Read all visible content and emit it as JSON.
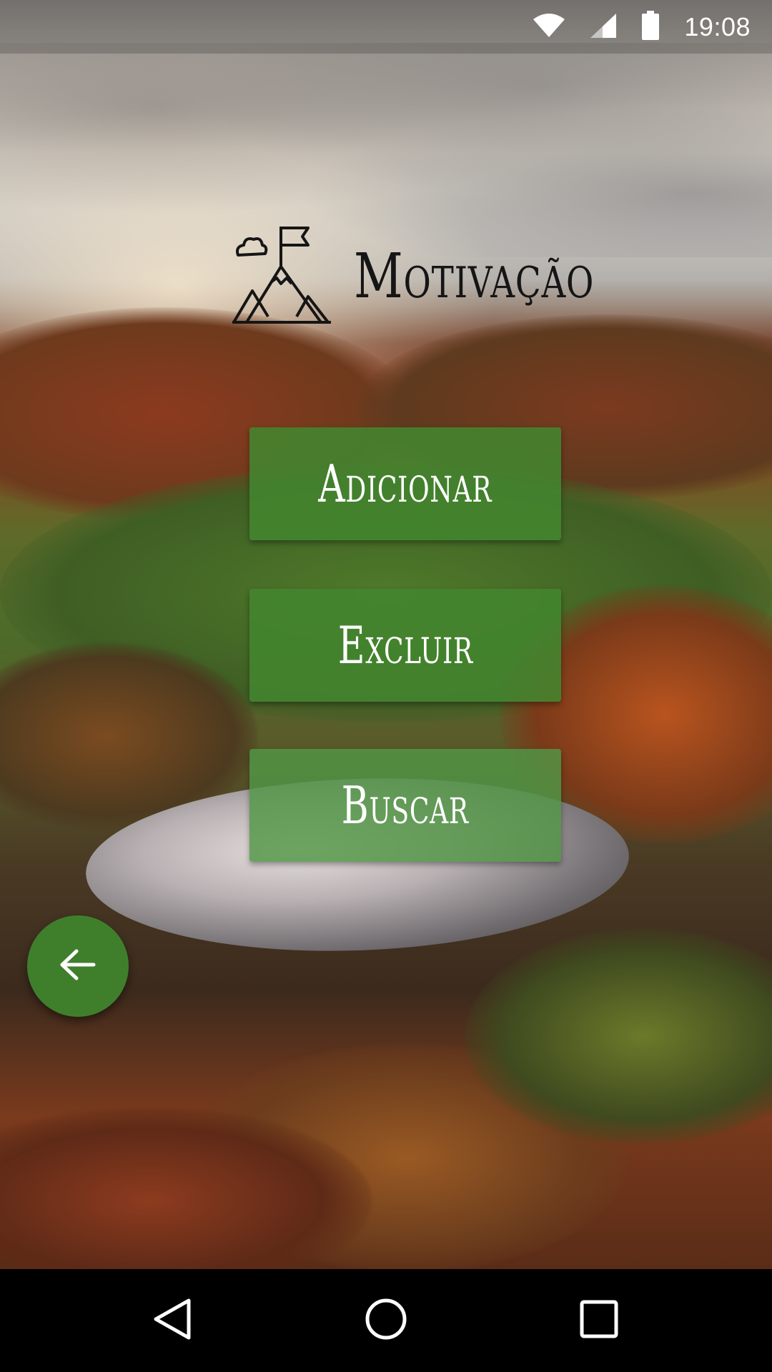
{
  "status_bar": {
    "time": "19:08",
    "icons": [
      "wifi-icon",
      "cell-signal-icon",
      "battery-icon"
    ]
  },
  "app": {
    "title": "Motivação",
    "logo_icon": "mountain-flag-icon"
  },
  "buttons": {
    "add_label": "Adicionar",
    "delete_label": "Excluir",
    "search_label": "Buscar"
  },
  "fab": {
    "icon": "arrow-left-icon"
  },
  "nav_bar": {
    "icons": [
      "back-triangle-icon",
      "home-circle-icon",
      "recents-square-icon"
    ]
  },
  "colors": {
    "button_bg": "#43852F",
    "fab_bg": "#3F7F2C",
    "title_text": "#151515",
    "button_text": "#FFFFFF",
    "nav_bar_bg": "#000000"
  }
}
